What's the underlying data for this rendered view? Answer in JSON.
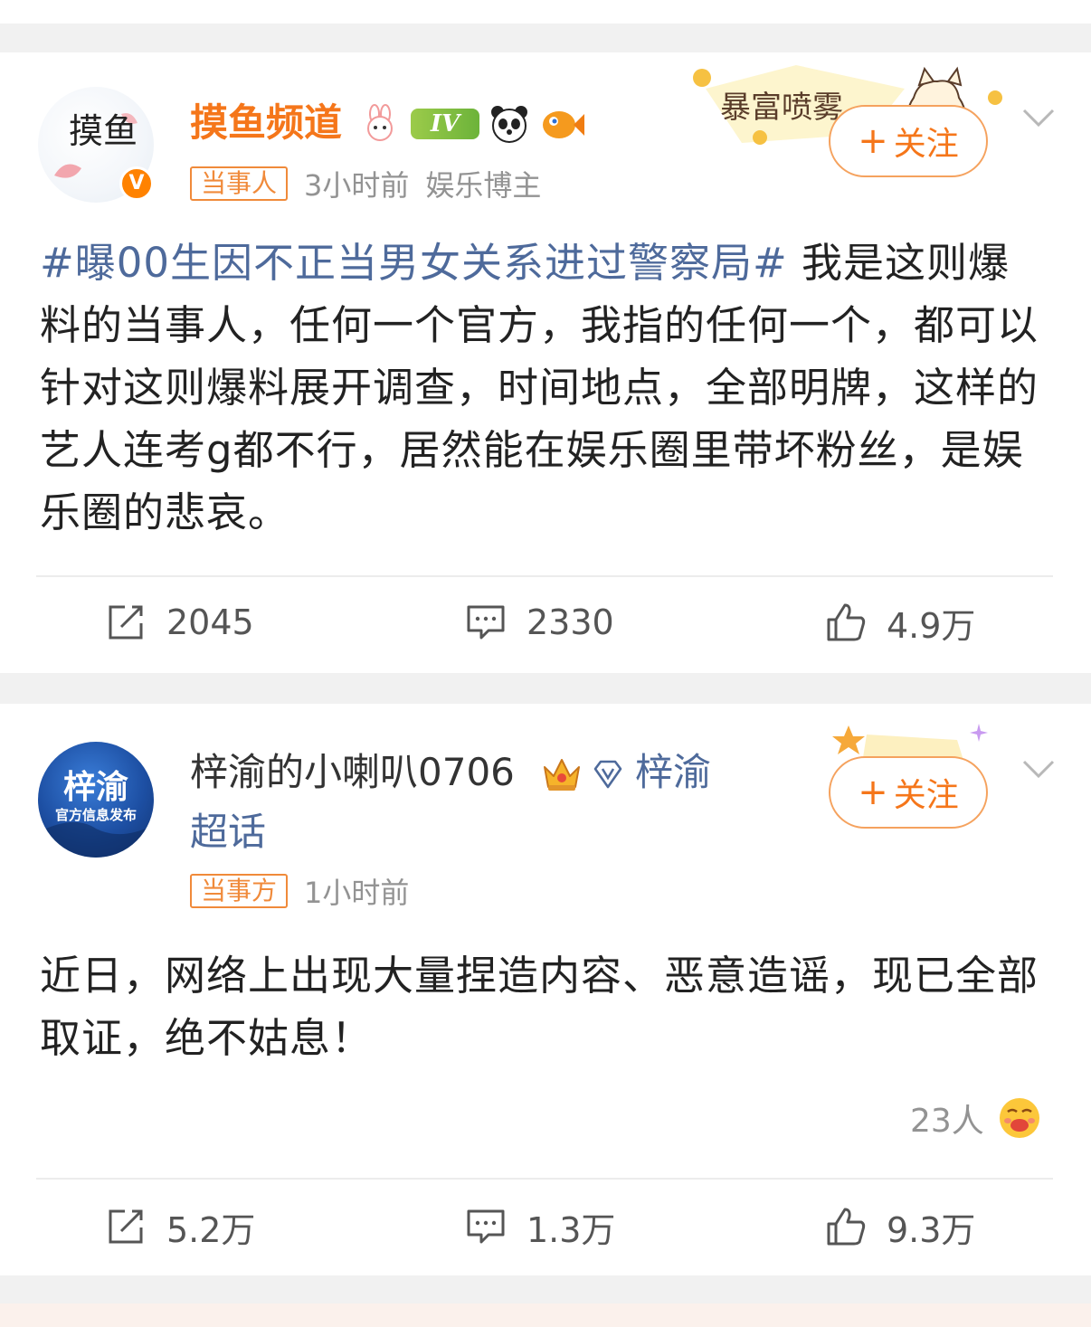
{
  "posts": [
    {
      "avatar_text": "摸鱼",
      "username": "摸鱼频道",
      "level_badge": "IV",
      "tag": "当事人",
      "time": "3小时前",
      "role": "娱乐博主",
      "banner_text": "暴富喷雾",
      "follow_label": "关注",
      "hashtag": "#曝00生因不正当男女关系进过警察局#",
      "body": " 我是这则爆料的当事人，任何一个官方，我指的任何一个，都可以针对这则爆料展开调查，时间地点，全部明牌，这样的艺人连考g都不行，居然能在娱乐圈里带坏粉丝，是娱乐圈的悲哀。",
      "reposts": "2045",
      "comments": "2330",
      "likes": "4.9万"
    },
    {
      "avatar_title": "梓渝",
      "avatar_subtitle": "官方信息发布",
      "username": "梓渝的小喇叭0706",
      "supertopic_line1": "梓渝",
      "supertopic_line2": "超话",
      "tag": "当事方",
      "time": "1小时前",
      "follow_label": "关注",
      "body": "近日，网络上出现大量捏造内容、恶意造谣，现已全部取证，绝不姑息！",
      "reactions": "23人",
      "reposts": "5.2万",
      "comments": "1.3万",
      "likes": "9.3万"
    }
  ],
  "colors": {
    "accent_orange": "#f5761a",
    "link_blue": "#4e6a9b",
    "page_bg": "#f1f1f1"
  },
  "icons": [
    "repost-icon",
    "comment-icon",
    "like-icon",
    "chevron-down-icon",
    "verified-v-icon",
    "panda-icon",
    "fish-icon",
    "bunny-icon",
    "crown-icon",
    "diamond-icon",
    "emoji-icon"
  ]
}
